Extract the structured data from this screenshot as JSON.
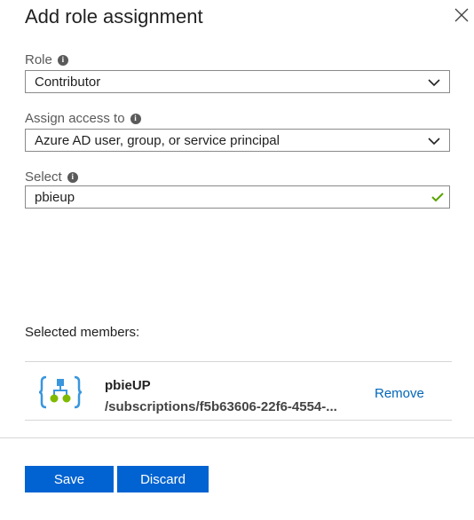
{
  "dialog": {
    "title": "Add role assignment"
  },
  "role": {
    "label": "Role",
    "value": "Contributor"
  },
  "assign_access": {
    "label": "Assign access to",
    "value": "Azure AD user, group, or service principal"
  },
  "select": {
    "label": "Select",
    "value": "pbieup"
  },
  "selected_members": {
    "label": "Selected members:",
    "items": [
      {
        "name": "pbieUP",
        "path": "/subscriptions/f5b63606-22f6-4554-...",
        "remove_label": "Remove"
      }
    ]
  },
  "actions": {
    "save_label": "Save",
    "discard_label": "Discard"
  },
  "colors": {
    "primary": "#0063d1",
    "link": "#0066b8",
    "success": "#57a300",
    "icon_blue": "#3a96dd",
    "icon_green": "#7fba00"
  }
}
